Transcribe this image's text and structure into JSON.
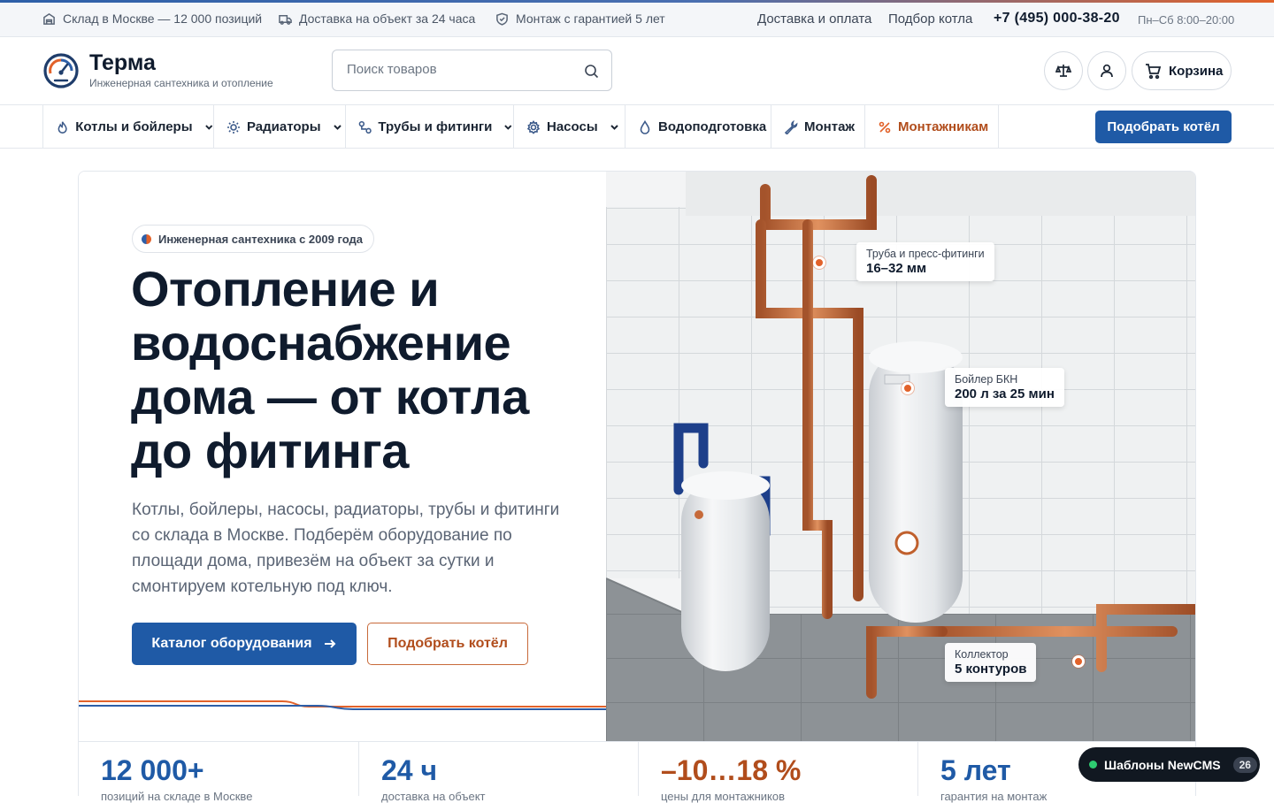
{
  "topbar": {
    "warehouse": "Склад в Москве — 12 000 позиций",
    "delivery": "Доставка на объект за 24 часа",
    "warranty": "Монтаж с гарантией 5 лет",
    "link_delivery": "Доставка и оплата",
    "link_boiler": "Подбор котла",
    "phone": "+7 (495) 000-38-20",
    "hours": "Пн–Сб 8:00–20:00"
  },
  "header": {
    "brand": "Терма",
    "tagline": "Инженерная сантехника и отопление",
    "search_placeholder": "Поиск товаров",
    "cart_label": "Корзина"
  },
  "nav": {
    "items": [
      {
        "label": "Котлы и бойлеры",
        "icon": "flame-icon",
        "dropdown": true
      },
      {
        "label": "Радиаторы",
        "icon": "sun-icon",
        "dropdown": true
      },
      {
        "label": "Трубы и фитинги",
        "icon": "pipe-icon",
        "dropdown": true
      },
      {
        "label": "Насосы",
        "icon": "gear-icon",
        "dropdown": true
      },
      {
        "label": "Водоподготовка",
        "icon": "drop-icon",
        "dropdown": false
      },
      {
        "label": "Монтаж",
        "icon": "wrench-icon",
        "dropdown": false
      },
      {
        "label": "Монтажникам",
        "icon": "percent-icon",
        "dropdown": false
      }
    ],
    "cta": "Подобрать котёл"
  },
  "hero": {
    "badge": "Инженерная сантехника с 2009 года",
    "title": "Отопление и водоснабжение дома — от котла до фитинга",
    "lead": "Котлы, бойлеры, насосы, радиаторы, трубы и фитинги со склада в Москве. Подберём оборудование по площади дома, привезём на объект за сутки и смонтируем котельную под ключ.",
    "btn_catalog": "Каталог оборудования",
    "btn_boiler": "Подобрать котёл",
    "callouts": [
      {
        "label": "Труба и пресс-фитинги",
        "value": "16–32 мм"
      },
      {
        "label": "Бойлер БКН",
        "value": "200 л за 25 мин"
      },
      {
        "label": "Коллектор",
        "value": "5 контуров"
      }
    ]
  },
  "stats": [
    {
      "value": "12 000+",
      "label": "позиций на складе в Москве"
    },
    {
      "value": "24 ч",
      "label": "доставка на объект"
    },
    {
      "value": "–10…18 %",
      "label": "цены для монтажников"
    },
    {
      "value": "5 лет",
      "label": "гарантия на монтаж"
    }
  ],
  "toast": {
    "label": "Шаблоны NewCMS",
    "count": "26"
  },
  "colors": {
    "primary": "#1f5aa6",
    "accent": "#e2622a",
    "accent_text": "#b14d1c",
    "dark": "#0f1b2d"
  }
}
